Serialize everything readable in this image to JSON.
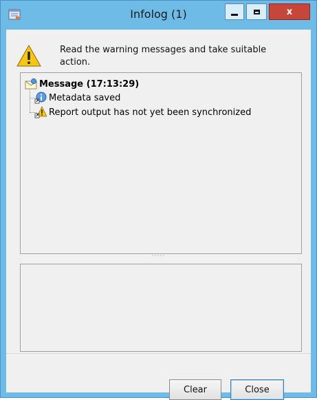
{
  "window": {
    "title": "Infolog (1)",
    "close_glyph": "x",
    "accent_color": "#6fbbe8",
    "close_color": "#c7463a"
  },
  "header": {
    "instruction": "Read the warning messages and take suitable action.",
    "icon": "warning-icon"
  },
  "tree": {
    "root": {
      "label": "Message (17:13:29)",
      "icon": "message-envelope-icon"
    },
    "children": [
      {
        "label": "Metadata saved",
        "icon": "info-icon"
      },
      {
        "label": "Report output has not yet been synchronized",
        "icon": "warning-icon"
      }
    ]
  },
  "splitter": {
    "glyph": "·····"
  },
  "buttons": {
    "clear": "Clear",
    "close": "Close"
  }
}
